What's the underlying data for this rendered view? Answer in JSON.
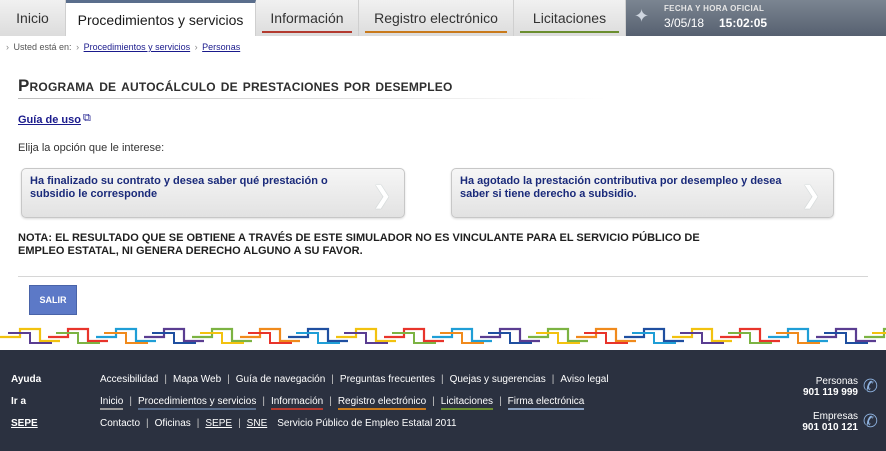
{
  "nav": {
    "tabs": [
      {
        "label": "Inicio",
        "accent": "#8a8a8a"
      },
      {
        "label": "Procedimientos y servicios",
        "accent": "#5a6e8c"
      },
      {
        "label": "Información",
        "accent": "#b33a2f"
      },
      {
        "label": "Registro electrónico",
        "accent": "#c97a1b"
      },
      {
        "label": "Licitaciones",
        "accent": "#6b8e2f"
      }
    ],
    "active_tab": "Procedimientos y servicios",
    "clock": {
      "label": "Fecha y hora oficial",
      "date": "3/05/18",
      "time": "15:02:05"
    }
  },
  "breadcrumb": {
    "prefix": "Usted está en:",
    "items": [
      "Procedimientos y servicios",
      "Personas"
    ]
  },
  "main": {
    "title": "Programa de autocálculo de prestaciones por desempleo",
    "guide_link": "Guía de uso",
    "instruction": "Elija la opción que le interese:",
    "options": [
      "Ha finalizado su contrato y desea saber qué prestación o subsidio le corresponde",
      "Ha agotado la prestación contributiva por desempleo y desea saber si tiene derecho a subsidio."
    ],
    "note": "NOTA: EL RESULTADO QUE SE OBTIENE A TRAVÉS DE ESTE SIMULADOR NO ES VINCULANTE PARA EL SERVICIO PÚBLICO DE EMPLEO ESTATAL, NI GENERA DERECHO ALGUNO A SU FAVOR.",
    "exit_label": "SALIR"
  },
  "footer": {
    "rows": [
      {
        "label": "Ayuda",
        "links": [
          "Accesibilidad",
          "Mapa Web",
          "Guía de navegación",
          "Preguntas frecuentes",
          "Quejas y sugerencias",
          "Aviso legal"
        ]
      },
      {
        "label": "Ir a",
        "links": [
          "Inicio",
          "Procedimientos y servicios",
          "Información",
          "Registro electrónico",
          "Licitaciones",
          "Firma electrónica"
        ]
      },
      {
        "label": "SEPE",
        "links": [
          "Contacto",
          "Oficinas",
          "SEPE",
          "SNE"
        ],
        "tail": "Servicio Público de Empleo Estatal 2011"
      }
    ],
    "phones": [
      {
        "label": "Personas",
        "number": "901 119 999"
      },
      {
        "label": "Empresas",
        "number": "901 010 121"
      }
    ]
  },
  "colors": {
    "footer_bg": "#2b3140",
    "link_blue": "#1a1a8c",
    "button_blue": "#5c79c7"
  }
}
